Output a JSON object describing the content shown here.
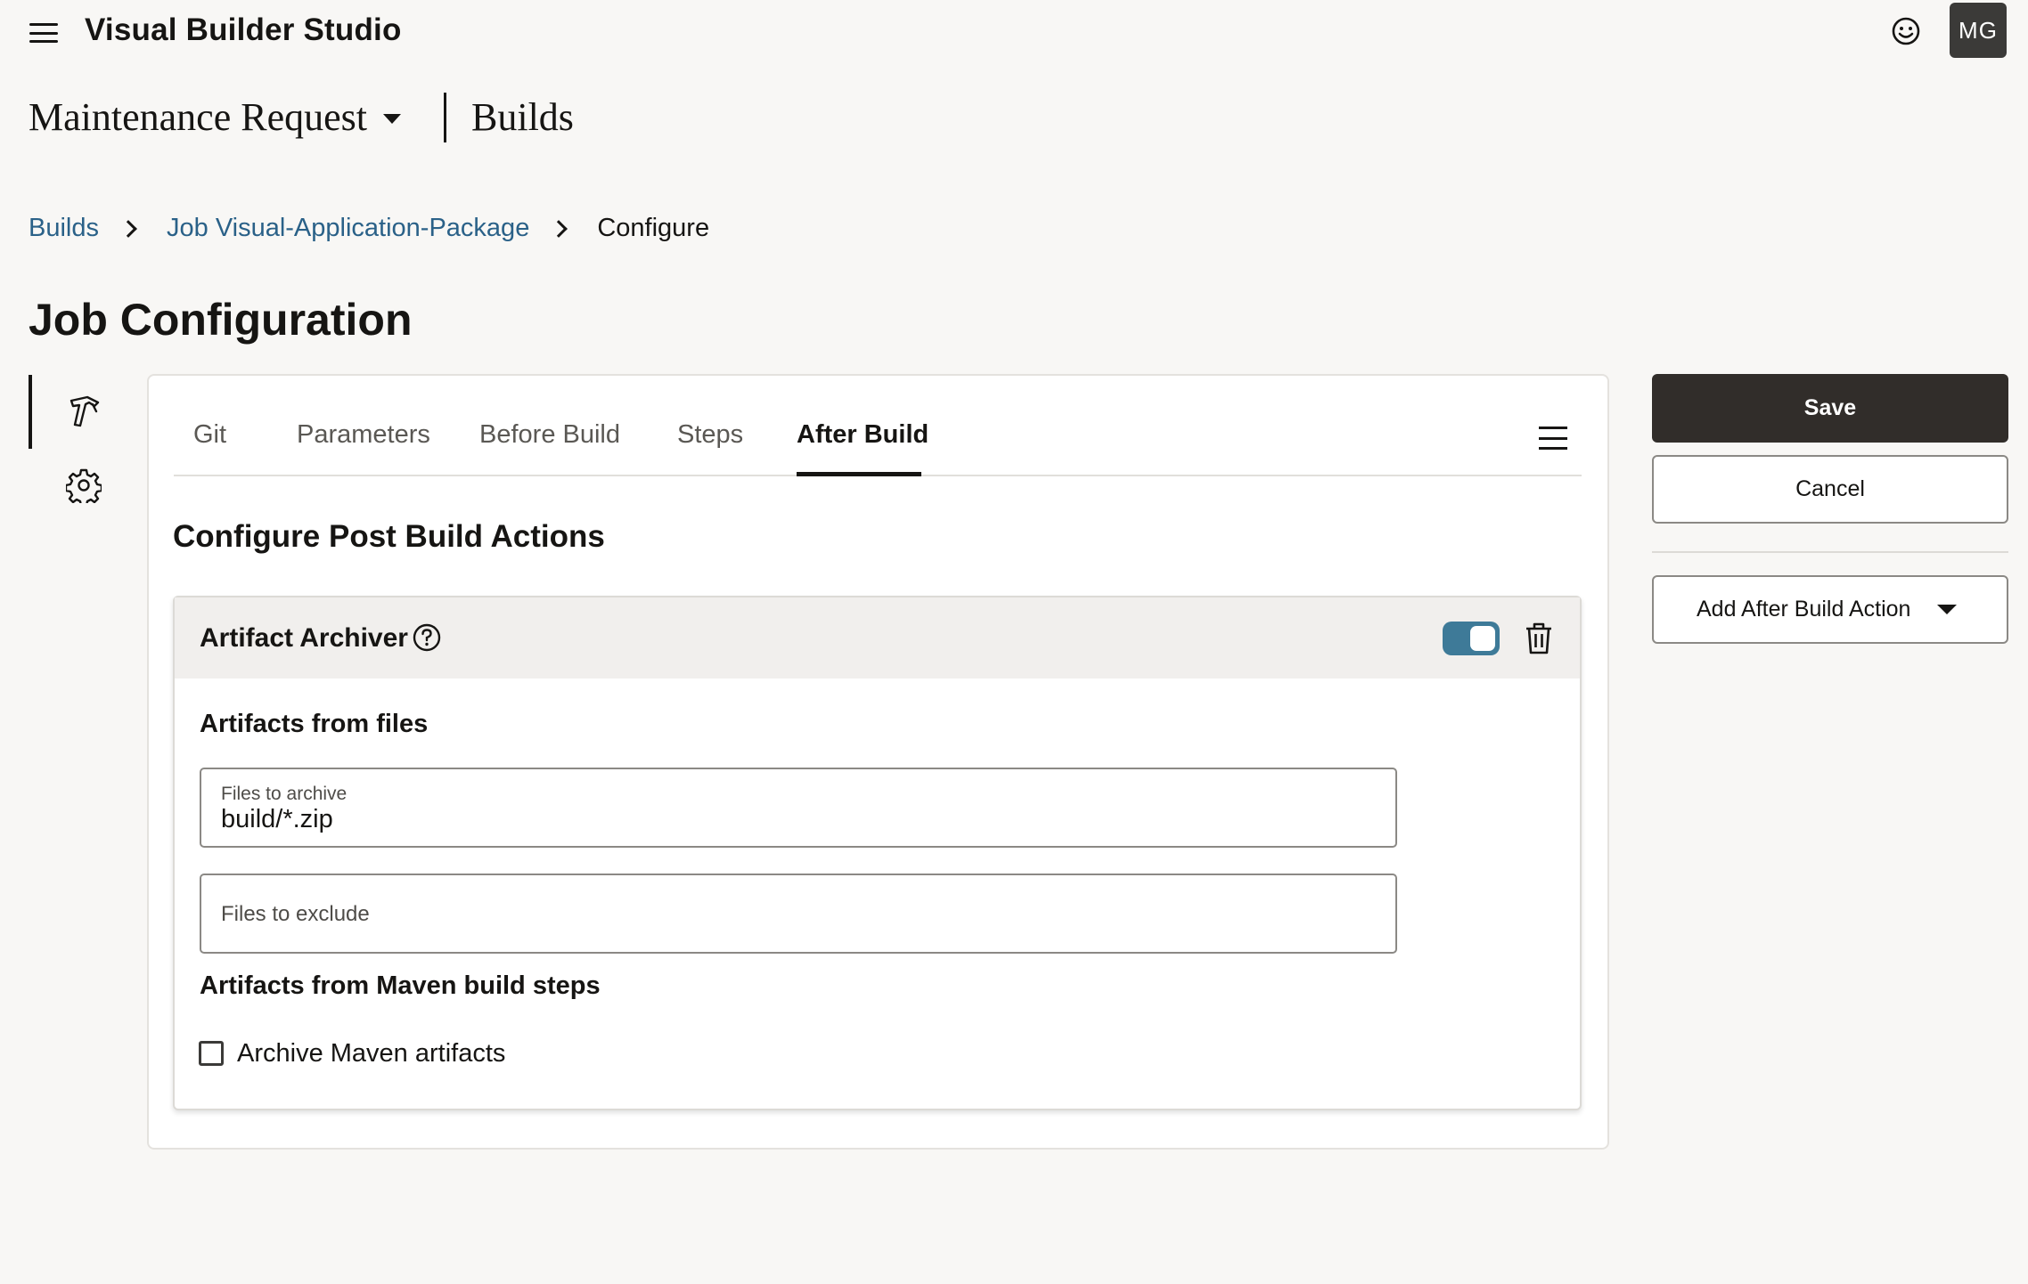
{
  "app": {
    "title": "Visual Builder Studio",
    "user_initials": "MG"
  },
  "project": {
    "name": "Maintenance Request",
    "section": "Builds"
  },
  "breadcrumb": {
    "items": [
      "Builds",
      "Job Visual-Application-Package"
    ],
    "current": "Configure"
  },
  "page": {
    "title": "Job Configuration"
  },
  "tabs": [
    {
      "label": "Git"
    },
    {
      "label": "Parameters"
    },
    {
      "label": "Before Build"
    },
    {
      "label": "Steps"
    },
    {
      "label": "After Build"
    }
  ],
  "active_tab": "After Build",
  "main": {
    "section_title": "Configure Post Build Actions",
    "archiver": {
      "title": "Artifact Archiver",
      "enabled": true,
      "files_heading": "Artifacts from files",
      "files_to_archive": {
        "label": "Files to archive",
        "value": "build/*.zip"
      },
      "files_to_exclude": {
        "placeholder": "Files to exclude",
        "value": ""
      },
      "maven_heading": "Artifacts from Maven build steps",
      "archive_maven": {
        "label": "Archive Maven artifacts",
        "checked": false
      }
    }
  },
  "actions": {
    "save": "Save",
    "cancel": "Cancel",
    "add_action": "Add After Build Action"
  },
  "icons": {
    "menu": "hamburger-icon",
    "feedback": "smiley-icon",
    "rail_build": "hammer-icon",
    "rail_settings": "gear-icon",
    "help": "help-circle-icon",
    "delete": "trash-icon"
  },
  "colors": {
    "link": "#2a6188",
    "toggle_on": "#3e7a98",
    "primary_button": "#312d2a",
    "background": "#f8f7f5"
  }
}
